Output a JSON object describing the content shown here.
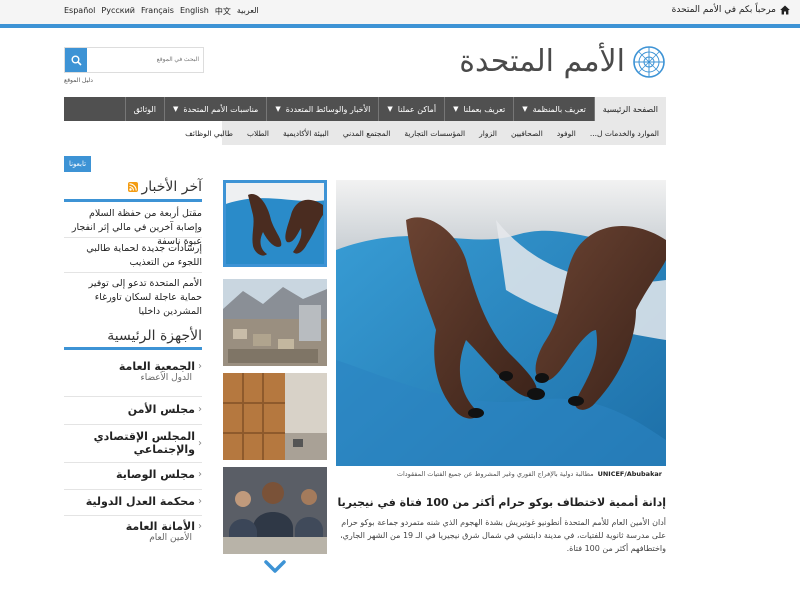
{
  "top_bar": {
    "languages": [
      "Español",
      "Русский",
      "Français",
      "English",
      "中文",
      "العربية"
    ],
    "welcome": "مرحباً بكم في الأمم المتحدة",
    "icon": "home-icon"
  },
  "header": {
    "title": "الأمم المتحدة",
    "emblem_icon": "un-emblem-icon",
    "search_placeholder": "البحث في الموقع",
    "site_index": "دليل الموقع"
  },
  "nav": {
    "items": [
      {
        "label": "الصفحة الرئيسية",
        "caret": false
      },
      {
        "label": "تعريف بالمنظمة",
        "caret": true
      },
      {
        "label": "تعريف بعملنا",
        "caret": true
      },
      {
        "label": "أماكن عملنا",
        "caret": true
      },
      {
        "label": "الأخبار والوسائط المتعددة",
        "caret": true
      },
      {
        "label": "مناسبات الأمم المتحدة",
        "caret": true
      },
      {
        "label": "الوثائق",
        "caret": false
      }
    ],
    "sub_items": [
      "الموارد والخدمات ل...",
      "الوفود",
      "الصحافيين",
      "الزوار",
      "المؤسسات التجارية",
      "المجتمع المدني",
      "البيئة الأكاديمية",
      "الطلاب",
      "طالبي الوظائف"
    ]
  },
  "follow_button": "تابعونا",
  "feature": {
    "credit": "UNICEF/Abubakar",
    "caption": "مطالبة دولية بالإفراج الفوري وغير المشروط عن جميع الفتيات المفقودات",
    "title": "إدانة أممية لاختطاف بوكو حرام أكثر من 100 فتاة في نيجيريا",
    "body": "أدان الأمين العام للأمم المتحدة أنطونيو غوتيريش بشدة الهجوم الذي شنه متمردو جماعة بوكو حرام على مدرسة ثانوية للفتيات، في مدينة دابتشي في شمال شرق نيجيريا في الـ 19 من الشهر الجاري، واختطافهم أكثر من 100 فتاة."
  },
  "latest_news": {
    "heading": "آخر الأخبار",
    "items": [
      "مقتل أربعة من حفظة السلام وإصابة آخرين في مالي إثر انفجار عبوة ناسفة",
      "إرشادات جديدة لحماية طالبي اللجوء من التعذيب",
      "الأمم المتحدة تدعو إلى توفير حماية عاجلة لسكان تاورغاء المشردين داخليا"
    ]
  },
  "main_organs": {
    "heading": "الأجهزة الرئيسية",
    "items": [
      {
        "name": "الجمعية العامة",
        "sub": "الدول الأعضاء"
      },
      {
        "name": "مجلس الأمن",
        "sub": ""
      },
      {
        "name": "المجلس الإقتصادي والإجتماعي",
        "sub": ""
      },
      {
        "name": "مجلس الوصاية",
        "sub": ""
      },
      {
        "name": "محكمة العدل الدولية",
        "sub": ""
      },
      {
        "name": "الأمانة العامة",
        "sub": "الأمين العام"
      }
    ]
  },
  "colors": {
    "accent": "#3d93d5",
    "nav_bg": "#505050",
    "rss": "#f39c12"
  }
}
